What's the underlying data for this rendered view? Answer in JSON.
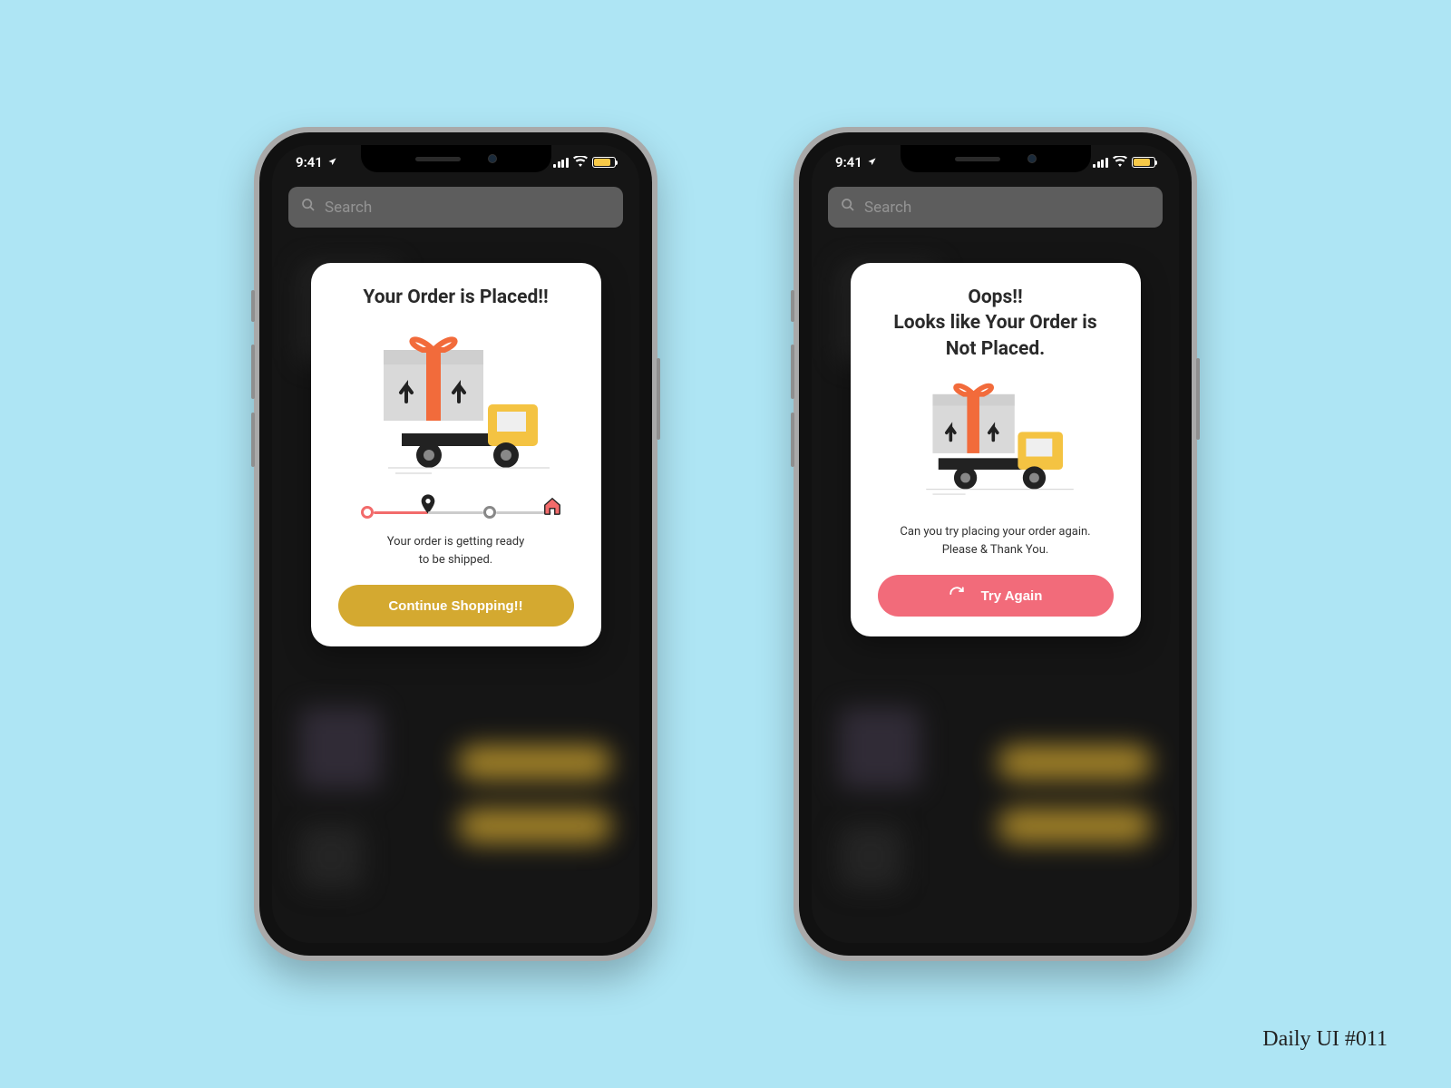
{
  "caption": "Daily UI #011",
  "status": {
    "time": "9:41",
    "search_placeholder": "Search"
  },
  "success": {
    "title": "Your Order is Placed!!",
    "subtext_line1": "Your order is getting ready",
    "subtext_line2": "to be shipped.",
    "cta": "Continue Shopping!!"
  },
  "error": {
    "title_line1": "Oops!!",
    "title_line2": "Looks like Your Order is",
    "title_line3": "Not Placed.",
    "subtext_line1": "Can you try placing your order again.",
    "subtext_line2": "Please & Thank You.",
    "cta": "Try Again"
  }
}
